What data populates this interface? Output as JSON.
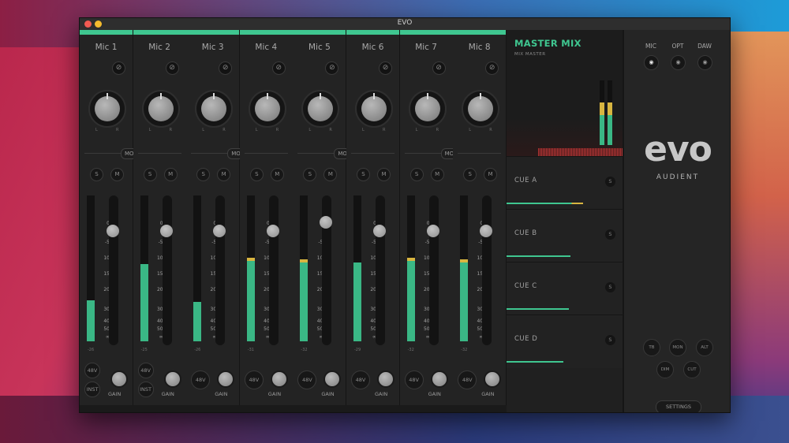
{
  "window": {
    "title": "EVO"
  },
  "colors": {
    "accent": "#3fc690",
    "meter_green": "#3ab785",
    "meter_peak": "#d8b540",
    "close": "#f05a52",
    "minimize": "#f4bb2e"
  },
  "icons": {
    "phase": "phase-invert-icon",
    "eye": "eye-icon"
  },
  "channels": [
    {
      "name": "Mic 1",
      "mute": "M",
      "solo": "S",
      "btn_a": "48V",
      "btn_b": "INST",
      "gain": "GAIN",
      "level": 0.28,
      "peak": false,
      "peak_label": "-26",
      "fader": 0.92
    },
    {
      "name": "Mic 2",
      "mute": "M",
      "solo": "S",
      "btn_a": "48V",
      "btn_b": "INST",
      "gain": "GAIN",
      "level": 0.53,
      "peak": false,
      "peak_label": "-25",
      "fader": 0.92
    },
    {
      "name": "Mic 3",
      "mute": "M",
      "solo": "S",
      "btn_a": "48V",
      "gain": "GAIN",
      "level": 0.27,
      "peak": false,
      "peak_label": "-26",
      "fader": 0.92
    },
    {
      "name": "Mic 4",
      "mute": "M",
      "solo": "S",
      "btn_a": "48V",
      "gain": "GAIN",
      "level": 0.55,
      "peak": true,
      "peak_label": "-31",
      "fader": 0.92
    },
    {
      "name": "Mic 5",
      "mute": "M",
      "solo": "S",
      "btn_a": "48V",
      "gain": "GAIN",
      "level": 0.54,
      "peak": true,
      "peak_label": "-32",
      "fader": 0.98
    },
    {
      "name": "Mic 6",
      "mute": "M",
      "solo": "S",
      "btn_a": "48V",
      "gain": "GAIN",
      "level": 0.54,
      "peak": false,
      "peak_label": "-29",
      "fader": 0.92
    },
    {
      "name": "Mic 7",
      "mute": "M",
      "solo": "S",
      "btn_a": "48V",
      "gain": "GAIN",
      "level": 0.55,
      "peak": true,
      "peak_label": "-32",
      "fader": 0.92
    },
    {
      "name": "Mic 8",
      "mute": "M",
      "solo": "S",
      "btn_a": "48V",
      "gain": "GAIN",
      "level": 0.54,
      "peak": true,
      "peak_label": "-32",
      "fader": 0.92
    }
  ],
  "pan_labels": {
    "left": "L",
    "right": "R"
  },
  "stereo_link": [
    "MONO",
    "MONO",
    "MONO",
    "MONO"
  ],
  "fader_scale": [
    "0",
    "-5",
    "10",
    "15",
    "20",
    "30",
    "40",
    "50",
    "∞"
  ],
  "master": {
    "title": "MASTER MIX",
    "subtitle": "MIX MASTER",
    "meter_left": 0.73,
    "meter_right": 0.73,
    "cues": [
      {
        "name": "CUE A",
        "btn": "S",
        "level": 0.66
      },
      {
        "name": "CUE B",
        "btn": "S",
        "level": 0.55
      },
      {
        "name": "CUE C",
        "btn": "S",
        "level": 0.54
      },
      {
        "name": "CUE D",
        "btn": "S",
        "level": 0.49
      }
    ]
  },
  "sidebar": {
    "sources": [
      "MIC",
      "OPT",
      "DAW"
    ],
    "logo": "evo",
    "brand": "AUDIENT",
    "controls": [
      "TB",
      "MON",
      "ALT",
      "DIM",
      "CUT"
    ],
    "settings": "SETTINGS"
  }
}
